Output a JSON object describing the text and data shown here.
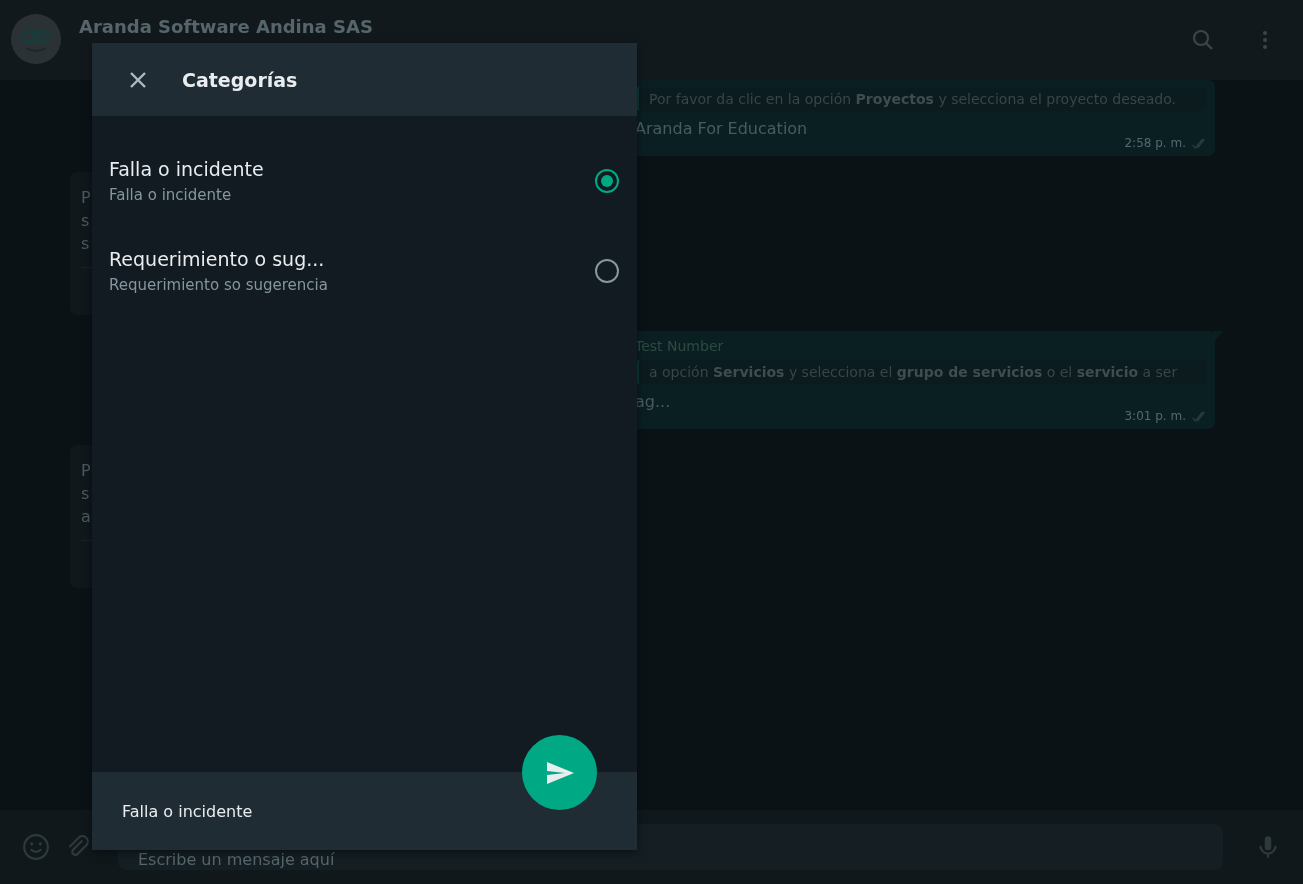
{
  "chat": {
    "title": "Aranda Software Andina SAS"
  },
  "messages": [
    {
      "kind": "outgoing",
      "quote": "Por favor da clic en la opción **Proyectos** y selecciona el proyecto deseado.",
      "lines": [
        "Aranda For Education"
      ],
      "time": "2:58 p. m."
    },
    {
      "kind": "incoming",
      "lines": [
        "P",
        "s",
        "s"
      ]
    },
    {
      "kind": "outgoing",
      "sender": "Test Number",
      "quote": "a opción **Servicios** y selecciona el **grupo de servicios** o el **servicio** a ser",
      "lines": [
        "ag..."
      ],
      "time": "3:01 p. m."
    },
    {
      "kind": "incoming",
      "lines": [
        "P",
        "s",
        "a"
      ]
    }
  ],
  "composer": {
    "placeholder": "Escribe un mensaje aquí"
  },
  "dialog": {
    "title": "Categorías",
    "options": [
      {
        "title": "Falla o incidente",
        "description": "Falla o incidente",
        "selected": true
      },
      {
        "title": "Requerimiento o sug...",
        "description": "Requerimiento so sugerencia",
        "selected": false
      }
    ],
    "selection": "Falla o incidente"
  }
}
